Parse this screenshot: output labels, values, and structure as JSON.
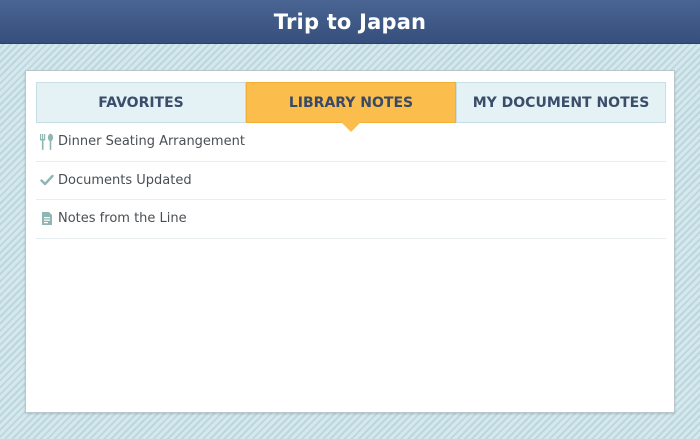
{
  "header": {
    "title": "Trip to Japan"
  },
  "tabs": [
    {
      "label": "FAVORITES",
      "active": false
    },
    {
      "label": "LIBRARY NOTES",
      "active": true
    },
    {
      "label": "MY DOCUMENT NOTES",
      "active": false
    }
  ],
  "notes": [
    {
      "icon": "utensils-icon",
      "label": "Dinner Seating Arrangement"
    },
    {
      "icon": "checkmark-icon",
      "label": "Documents Updated"
    },
    {
      "icon": "note-icon",
      "label": "Notes from the Line"
    }
  ],
  "colors": {
    "header": "#3f5987",
    "active_tab": "#fbbd4c",
    "inactive_tab": "#e4f1f5",
    "icon": "#8fb6b3"
  }
}
